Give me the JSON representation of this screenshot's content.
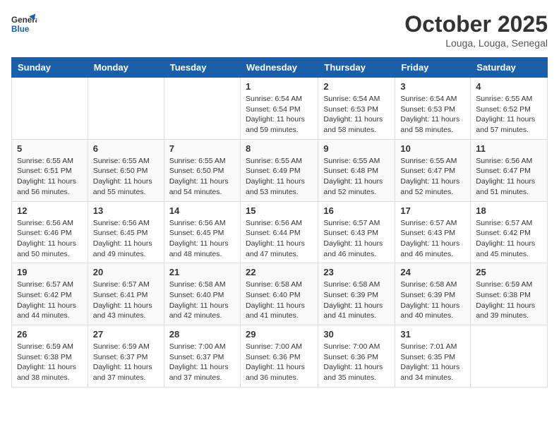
{
  "header": {
    "logo_line1": "General",
    "logo_line2": "Blue",
    "month": "October 2025",
    "location": "Louga, Louga, Senegal"
  },
  "days_of_week": [
    "Sunday",
    "Monday",
    "Tuesday",
    "Wednesday",
    "Thursday",
    "Friday",
    "Saturday"
  ],
  "weeks": [
    [
      {
        "day": "",
        "info": ""
      },
      {
        "day": "",
        "info": ""
      },
      {
        "day": "",
        "info": ""
      },
      {
        "day": "1",
        "info": "Sunrise: 6:54 AM\nSunset: 6:54 PM\nDaylight: 11 hours\nand 59 minutes."
      },
      {
        "day": "2",
        "info": "Sunrise: 6:54 AM\nSunset: 6:53 PM\nDaylight: 11 hours\nand 58 minutes."
      },
      {
        "day": "3",
        "info": "Sunrise: 6:54 AM\nSunset: 6:53 PM\nDaylight: 11 hours\nand 58 minutes."
      },
      {
        "day": "4",
        "info": "Sunrise: 6:55 AM\nSunset: 6:52 PM\nDaylight: 11 hours\nand 57 minutes."
      }
    ],
    [
      {
        "day": "5",
        "info": "Sunrise: 6:55 AM\nSunset: 6:51 PM\nDaylight: 11 hours\nand 56 minutes."
      },
      {
        "day": "6",
        "info": "Sunrise: 6:55 AM\nSunset: 6:50 PM\nDaylight: 11 hours\nand 55 minutes."
      },
      {
        "day": "7",
        "info": "Sunrise: 6:55 AM\nSunset: 6:50 PM\nDaylight: 11 hours\nand 54 minutes."
      },
      {
        "day": "8",
        "info": "Sunrise: 6:55 AM\nSunset: 6:49 PM\nDaylight: 11 hours\nand 53 minutes."
      },
      {
        "day": "9",
        "info": "Sunrise: 6:55 AM\nSunset: 6:48 PM\nDaylight: 11 hours\nand 52 minutes."
      },
      {
        "day": "10",
        "info": "Sunrise: 6:55 AM\nSunset: 6:47 PM\nDaylight: 11 hours\nand 52 minutes."
      },
      {
        "day": "11",
        "info": "Sunrise: 6:56 AM\nSunset: 6:47 PM\nDaylight: 11 hours\nand 51 minutes."
      }
    ],
    [
      {
        "day": "12",
        "info": "Sunrise: 6:56 AM\nSunset: 6:46 PM\nDaylight: 11 hours\nand 50 minutes."
      },
      {
        "day": "13",
        "info": "Sunrise: 6:56 AM\nSunset: 6:45 PM\nDaylight: 11 hours\nand 49 minutes."
      },
      {
        "day": "14",
        "info": "Sunrise: 6:56 AM\nSunset: 6:45 PM\nDaylight: 11 hours\nand 48 minutes."
      },
      {
        "day": "15",
        "info": "Sunrise: 6:56 AM\nSunset: 6:44 PM\nDaylight: 11 hours\nand 47 minutes."
      },
      {
        "day": "16",
        "info": "Sunrise: 6:57 AM\nSunset: 6:43 PM\nDaylight: 11 hours\nand 46 minutes."
      },
      {
        "day": "17",
        "info": "Sunrise: 6:57 AM\nSunset: 6:43 PM\nDaylight: 11 hours\nand 46 minutes."
      },
      {
        "day": "18",
        "info": "Sunrise: 6:57 AM\nSunset: 6:42 PM\nDaylight: 11 hours\nand 45 minutes."
      }
    ],
    [
      {
        "day": "19",
        "info": "Sunrise: 6:57 AM\nSunset: 6:42 PM\nDaylight: 11 hours\nand 44 minutes."
      },
      {
        "day": "20",
        "info": "Sunrise: 6:57 AM\nSunset: 6:41 PM\nDaylight: 11 hours\nand 43 minutes."
      },
      {
        "day": "21",
        "info": "Sunrise: 6:58 AM\nSunset: 6:40 PM\nDaylight: 11 hours\nand 42 minutes."
      },
      {
        "day": "22",
        "info": "Sunrise: 6:58 AM\nSunset: 6:40 PM\nDaylight: 11 hours\nand 41 minutes."
      },
      {
        "day": "23",
        "info": "Sunrise: 6:58 AM\nSunset: 6:39 PM\nDaylight: 11 hours\nand 41 minutes."
      },
      {
        "day": "24",
        "info": "Sunrise: 6:58 AM\nSunset: 6:39 PM\nDaylight: 11 hours\nand 40 minutes."
      },
      {
        "day": "25",
        "info": "Sunrise: 6:59 AM\nSunset: 6:38 PM\nDaylight: 11 hours\nand 39 minutes."
      }
    ],
    [
      {
        "day": "26",
        "info": "Sunrise: 6:59 AM\nSunset: 6:38 PM\nDaylight: 11 hours\nand 38 minutes."
      },
      {
        "day": "27",
        "info": "Sunrise: 6:59 AM\nSunset: 6:37 PM\nDaylight: 11 hours\nand 37 minutes."
      },
      {
        "day": "28",
        "info": "Sunrise: 7:00 AM\nSunset: 6:37 PM\nDaylight: 11 hours\nand 37 minutes."
      },
      {
        "day": "29",
        "info": "Sunrise: 7:00 AM\nSunset: 6:36 PM\nDaylight: 11 hours\nand 36 minutes."
      },
      {
        "day": "30",
        "info": "Sunrise: 7:00 AM\nSunset: 6:36 PM\nDaylight: 11 hours\nand 35 minutes."
      },
      {
        "day": "31",
        "info": "Sunrise: 7:01 AM\nSunset: 6:35 PM\nDaylight: 11 hours\nand 34 minutes."
      },
      {
        "day": "",
        "info": ""
      }
    ]
  ]
}
